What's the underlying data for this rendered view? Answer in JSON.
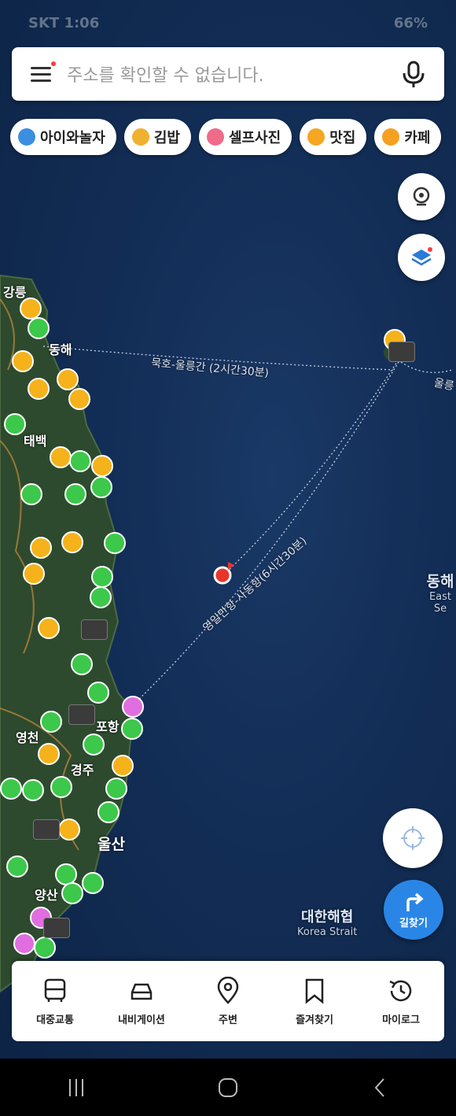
{
  "status": {
    "time": "SKT 1:06",
    "battery": "66%"
  },
  "search": {
    "placeholder": "주소를 확인할 수 없습니다."
  },
  "chips": [
    {
      "label": "아이와놀자",
      "color": "#3a8fe0"
    },
    {
      "label": "김밥",
      "color": "#f0b030"
    },
    {
      "label": "셀프사진",
      "color": "#f06a8a"
    },
    {
      "label": "맛집",
      "color": "#f5a623"
    },
    {
      "label": "카페",
      "color": "#f5a020"
    }
  ],
  "map": {
    "cities": [
      "강릉",
      "동해",
      "태백",
      "영천",
      "포항",
      "경주",
      "울산",
      "양산"
    ],
    "ferry_routes": [
      "묵호-울릉간 (2시간30분)",
      "영일만항-사동항(6시간30분)",
      "울릉"
    ],
    "seas": [
      {
        "name": "동해",
        "sub": "East Se"
      },
      {
        "name": "대한해협",
        "sub": "Korea Strait"
      }
    ]
  },
  "route_button": {
    "label": "길찾기"
  },
  "bottom_nav": [
    {
      "label": "대중교통",
      "icon": "bus-icon"
    },
    {
      "label": "내비게이션",
      "icon": "car-icon"
    },
    {
      "label": "주변",
      "icon": "pin-icon"
    },
    {
      "label": "즐겨찾기",
      "icon": "bookmark-icon"
    },
    {
      "label": "마이로그",
      "icon": "history-icon"
    }
  ]
}
